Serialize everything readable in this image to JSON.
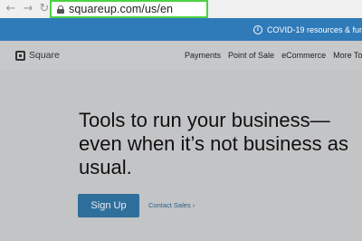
{
  "browser": {
    "back_icon": "arrow-left-icon",
    "forward_icon": "arrow-right-icon",
    "reload_icon": "reload-icon",
    "url": "squareup.com/us/en",
    "address_bar_highlight_color": "#4cd142"
  },
  "banner": {
    "text": "COVID-19 resources & fund",
    "icon": "info-icon",
    "color": "#2f7ab8"
  },
  "nav": {
    "logo_text": "Square",
    "links": [
      "Payments",
      "Point of Sale",
      "eCommerce",
      "More To"
    ]
  },
  "hero": {
    "title": "Tools to run your business—even when it’s not business as usual.",
    "signup_label": "Sign Up",
    "contact_label": "Contact Sales ›"
  }
}
